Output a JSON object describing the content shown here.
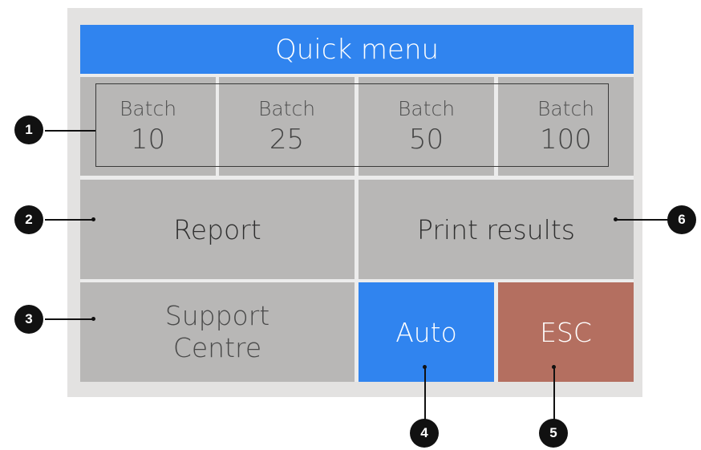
{
  "screen": {
    "title": "Quick menu",
    "batches": [
      {
        "label": "Batch",
        "value": "10"
      },
      {
        "label": "Batch",
        "value": "25"
      },
      {
        "label": "Batch",
        "value": "50"
      },
      {
        "label": "Batch",
        "value": "100"
      }
    ],
    "report_label": "Report",
    "print_label": "Print results",
    "support_label": "Support\nCentre",
    "auto_label": "Auto",
    "esc_label": "ESC"
  },
  "callouts": [
    "1",
    "2",
    "3",
    "4",
    "5",
    "6"
  ],
  "colors": {
    "title_bar": "#3084ef",
    "tile": "#b8b7b6",
    "auto": "#3084ef",
    "esc": "#b46f60",
    "callout": "#111111"
  }
}
